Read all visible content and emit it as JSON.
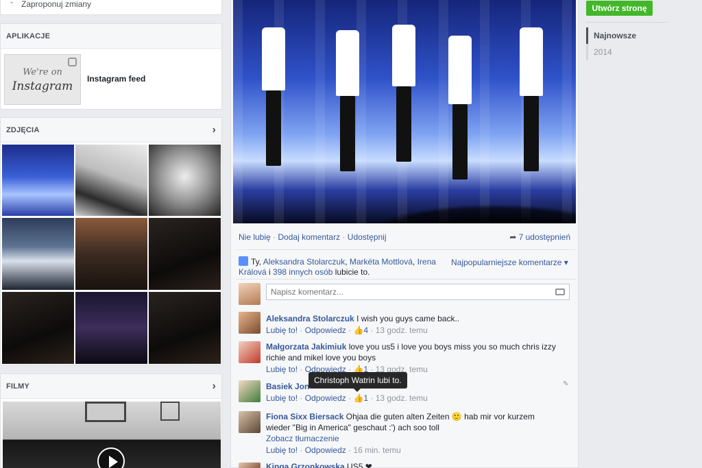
{
  "left": {
    "top_link": "Zaproponuj zmiany",
    "apps": {
      "header": "APLIKACJE",
      "item_label": "Instagram feed",
      "thumb_line1": "We're on",
      "thumb_line2": "Instagram"
    },
    "photos": {
      "header": "ZDJĘCIA"
    },
    "videos": {
      "header": "FILMY"
    }
  },
  "post": {
    "actions": {
      "unlike": "Nie lubię",
      "comment": "Dodaj komentarz",
      "share": "Udostępnij",
      "sep": "·",
      "shares": "7 udostępnień"
    },
    "likes": {
      "prefix": "Ty,",
      "names": [
        "Aleksandra Stolarczuk",
        "Markéta Mottlová",
        "Irena Králová"
      ],
      "and": "i",
      "others": "398 innych osób",
      "suffix": "lubicie to.",
      "sort_label": "Najpopularniejsze komentarze ▾"
    },
    "comment_input_placeholder": "Napisz komentarz...",
    "tooltip": "Christoph Watrin lubi to.",
    "comments": [
      {
        "name": "Aleksandra Stolarczuk",
        "text": "I wish you guys came back..",
        "like": "Lubię to!",
        "reply": "Odpowiedz",
        "likes": "4",
        "time": "13 godz. temu"
      },
      {
        "name": "Małgorzata Jakimiuk",
        "text": "love you us5 i love you boys miss you so much chris izzy richie and mikel love you boys",
        "like": "Lubię to!",
        "reply": "Odpowiedz",
        "likes": "1",
        "time": "13 godz. temu"
      },
      {
        "name": "Basiek Jon",
        "text": "",
        "like": "Lubię to!",
        "reply": "Odpowiedz",
        "likes": "1",
        "time": "13 godz. temu"
      },
      {
        "name": "Fiona Sixx Biersack",
        "text": "Ohjaa die guten alten Zeiten 🙂 hab mir vor kurzem wieder \"Big in America\" geschaut :') ach soo toll",
        "translate": "Zobacz tłumaczenie",
        "like": "Lubię to!",
        "reply": "Odpowiedz",
        "time": "16 min. temu"
      },
      {
        "name": "Kinga Grzonkowska",
        "text": "US5 ❤"
      }
    ]
  },
  "right": {
    "create_page_button": "Utwórz stronę",
    "timeline": [
      "Najnowsze",
      "2014"
    ]
  },
  "colors": {
    "accent_green": "#42b72a",
    "link": "#365899",
    "tooltip_bg": "#282828"
  }
}
